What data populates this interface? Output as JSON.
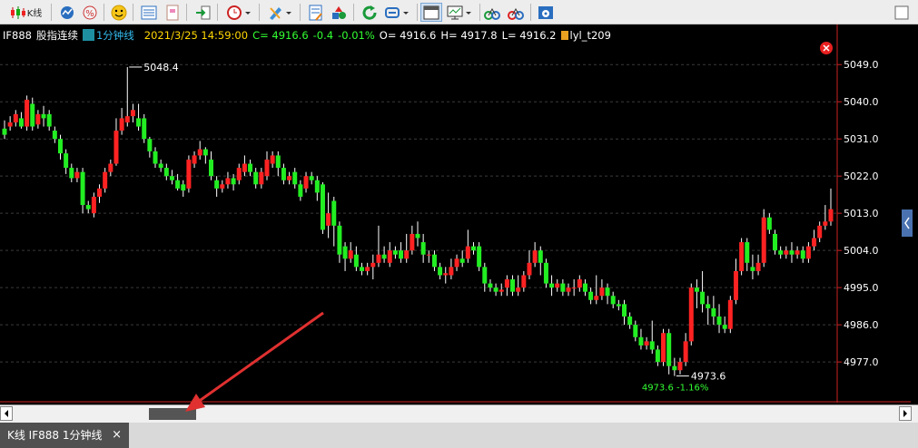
{
  "toolbar": {
    "kline_label": "K线"
  },
  "info": {
    "symbol": "IF888",
    "name": "股指连续",
    "period": "1分钟线",
    "datetime": "2021/3/25 14:59:00",
    "close": "C= 4916.6",
    "change": "-0.4",
    "pct": "-0.01%",
    "open": "O= 4916.6",
    "high": "H= 4917.8",
    "low": "L= 4916.2",
    "indicator": "lyl_t209"
  },
  "yaxis_ticks": [
    "5049.0",
    "5040.0",
    "5031.0",
    "5022.0",
    "5013.0",
    "5004.0",
    "4995.0",
    "4986.0",
    "4977.0"
  ],
  "annotations": {
    "high_label": "5048.4",
    "low_label": "4973.6",
    "low_change": "4973.6 -1.16%"
  },
  "tab": {
    "title": "K线 IF888 1分钟线",
    "close": "×"
  },
  "colors": {
    "up": "#ff2222",
    "down": "#22ee22",
    "axis": "#cc2222",
    "info_time": "#ffd700",
    "info_value": "#33ff33"
  },
  "chart_data": {
    "type": "candlestick",
    "ylim": [
      4970,
      5053
    ],
    "grid": true,
    "candles": [
      [
        5033.5,
        5032,
        5035.5,
        5031
      ],
      [
        5034,
        5035,
        5036.5,
        5033
      ],
      [
        5035,
        5037,
        5038,
        5034
      ],
      [
        5036,
        5034,
        5037.5,
        5033.5
      ],
      [
        5034,
        5040.5,
        5041.5,
        5033
      ],
      [
        5039.5,
        5034,
        5041,
        5033
      ],
      [
        5034.5,
        5037,
        5038,
        5033.5
      ],
      [
        5037,
        5036,
        5039,
        5034
      ],
      [
        5037,
        5034,
        5038,
        5033
      ],
      [
        5033,
        5031,
        5034,
        5030
      ],
      [
        5031,
        5027.5,
        5032,
        5026
      ],
      [
        5027.5,
        5024,
        5028.5,
        5022.5
      ],
      [
        5024,
        5021.5,
        5025,
        5020.5
      ],
      [
        5021.5,
        5023,
        5024,
        5020.5
      ],
      [
        5023,
        5015,
        5024,
        5013
      ],
      [
        5015,
        5014,
        5016,
        5013
      ],
      [
        5013,
        5017,
        5018,
        5012
      ],
      [
        5017,
        5019,
        5020,
        5015.5
      ],
      [
        5019,
        5023,
        5024,
        5018
      ],
      [
        5023,
        5025,
        5026,
        5022
      ],
      [
        5025,
        5033,
        5036,
        5024.5
      ],
      [
        5033,
        5036,
        5038.5,
        5032
      ],
      [
        5035,
        5036.5,
        5048.4,
        5034
      ],
      [
        5036.5,
        5038,
        5039.5,
        5035
      ],
      [
        5036,
        5034,
        5039.5,
        5033
      ],
      [
        5036,
        5031,
        5037,
        5030
      ],
      [
        5031,
        5028,
        5031.5,
        5026.5
      ],
      [
        5028,
        5025,
        5029,
        5024
      ],
      [
        5025,
        5024,
        5026,
        5023
      ],
      [
        5024,
        5022,
        5025,
        5021
      ],
      [
        5022,
        5021,
        5023.5,
        5020
      ],
      [
        5021,
        5019,
        5022.5,
        5018.5
      ],
      [
        5020,
        5018.5,
        5021,
        5017
      ],
      [
        5019,
        5026,
        5027,
        5018
      ],
      [
        5025,
        5027,
        5028,
        5024
      ],
      [
        5027,
        5028.5,
        5030.5,
        5026
      ],
      [
        5028.5,
        5027,
        5029,
        5025
      ],
      [
        5026,
        5022,
        5028,
        5021
      ],
      [
        5021,
        5019,
        5022,
        5017
      ],
      [
        5019,
        5020,
        5021,
        5018
      ],
      [
        5020,
        5021.5,
        5023,
        5019
      ],
      [
        5021.5,
        5020,
        5022.5,
        5018.5
      ],
      [
        5021,
        5024,
        5025,
        5020
      ],
      [
        5023,
        5025,
        5027,
        5022
      ],
      [
        5025,
        5023,
        5026,
        5022
      ],
      [
        5023,
        5020,
        5024,
        5019
      ],
      [
        5020,
        5023,
        5024,
        5019
      ],
      [
        5022,
        5026,
        5028,
        5021
      ],
      [
        5025,
        5027,
        5028,
        5024
      ],
      [
        5027,
        5024,
        5028,
        5022
      ],
      [
        5024,
        5021,
        5025,
        5020
      ],
      [
        5021,
        5022,
        5023,
        5020
      ],
      [
        5023,
        5020,
        5024,
        5019
      ],
      [
        5020,
        5017,
        5021,
        5016
      ],
      [
        5019,
        5022,
        5023,
        5018
      ],
      [
        5022,
        5021,
        5023,
        5020
      ],
      [
        5021,
        5018,
        5022,
        5016
      ],
      [
        5020,
        5009,
        5020.5,
        5008
      ],
      [
        5010,
        5013,
        5018,
        5007
      ],
      [
        5016,
        5010,
        5017,
        5005
      ],
      [
        5010,
        5003,
        5011,
        5001
      ],
      [
        5005,
        5002,
        5006,
        4999
      ],
      [
        5002,
        5004,
        5006,
        5001
      ],
      [
        5003,
        5000,
        5005,
        4999
      ],
      [
        5000,
        4999,
        5001,
        4998
      ],
      [
        4999,
        5000,
        5001,
        4998
      ],
      [
        5000,
        5001,
        5003,
        4997
      ],
      [
        5001,
        5003,
        5010,
        5000
      ],
      [
        5003,
        5002,
        5005,
        5001
      ],
      [
        5001,
        5004,
        5006,
        5000
      ],
      [
        5004,
        5003,
        5005,
        5002
      ],
      [
        5004,
        5002,
        5006,
        5001
      ],
      [
        5002,
        5004,
        5008,
        5001
      ],
      [
        5004,
        5008,
        5010,
        5003
      ],
      [
        5008,
        5007,
        5011,
        5005
      ],
      [
        5006,
        5003,
        5008,
        5001
      ],
      [
        5003,
        5003,
        5004,
        5001
      ],
      [
        5003,
        5000,
        5004,
        4999
      ],
      [
        5000,
        4998,
        5001,
        4997
      ],
      [
        4998,
        4998.5,
        5000,
        4996
      ],
      [
        4998,
        5000,
        5002,
        4997
      ],
      [
        5000,
        5002,
        5003,
        4999
      ],
      [
        5002,
        5001,
        5004,
        5000
      ],
      [
        5002,
        5005,
        5009,
        5001
      ],
      [
        5005,
        5004,
        5006,
        5003
      ],
      [
        5005,
        5000,
        5006,
        4999
      ],
      [
        5000,
        4996,
        5001,
        4994
      ],
      [
        4996,
        4995,
        4997,
        4994
      ],
      [
        4995,
        4994,
        4996,
        4993
      ],
      [
        4994,
        4994.5,
        4996,
        4993
      ],
      [
        4995,
        4997,
        4998,
        4993
      ],
      [
        4997,
        4994,
        4998,
        4993
      ],
      [
        4994,
        4995,
        4998,
        4993
      ],
      [
        4995,
        4998,
        4999,
        4994
      ],
      [
        4998,
        5001,
        5004,
        4997
      ],
      [
        5001,
        5004,
        5006,
        5000
      ],
      [
        5004,
        5001,
        5005,
        4998
      ],
      [
        5001,
        4996,
        5002,
        4995
      ],
      [
        4996,
        4995,
        4998,
        4993
      ],
      [
        4995,
        4996,
        4997,
        4994
      ],
      [
        4996,
        4994,
        4997,
        4993
      ],
      [
        4994,
        4995,
        4996,
        4993
      ],
      [
        4995,
        4995,
        4997,
        4993
      ],
      [
        4995,
        4997,
        4998,
        4994
      ],
      [
        4996,
        4994,
        4997,
        4993
      ],
      [
        4994,
        4992,
        4995,
        4991
      ],
      [
        4992,
        4993,
        4998,
        4991
      ],
      [
        4993,
        4995,
        4997,
        4992
      ],
      [
        4995,
        4993,
        4996,
        4991
      ],
      [
        4993,
        4991,
        4994,
        4990
      ],
      [
        4991,
        4990.5,
        4992,
        4989.5
      ],
      [
        4991,
        4988,
        4992,
        4986
      ],
      [
        4988,
        4986,
        4989,
        4985
      ],
      [
        4986,
        4983,
        4987,
        4982
      ],
      [
        4983,
        4981,
        4985,
        4980
      ],
      [
        4981,
        4982,
        4983,
        4980
      ],
      [
        4982,
        4980,
        4987,
        4979
      ],
      [
        4980,
        4977,
        4981,
        4976
      ],
      [
        4977,
        4984,
        4985,
        4976
      ],
      [
        4984,
        4976,
        4985,
        4974
      ],
      [
        4976,
        4975,
        4978,
        4973.6
      ],
      [
        4975,
        4977,
        4978,
        4974
      ],
      [
        4977,
        4982,
        4984,
        4976
      ],
      [
        4982,
        4995,
        4996,
        4981
      ],
      [
        4995,
        4994,
        4997,
        4990
      ],
      [
        4994,
        4991,
        4999,
        4989
      ],
      [
        4991,
        4990,
        4993,
        4986
      ],
      [
        4990,
        4988,
        4993,
        4986
      ],
      [
        4988,
        4986,
        4991,
        4984
      ],
      [
        4986,
        4985,
        4988,
        4984
      ],
      [
        4985,
        4992,
        4993,
        4984
      ],
      [
        4992,
        4999,
        5002,
        4991
      ],
      [
        4999,
        5006,
        5007,
        4998
      ],
      [
        5006,
        5001,
        5007,
        4999
      ],
      [
        5000,
        4999,
        5003,
        4997
      ],
      [
        4999,
        5001,
        5003,
        4998
      ],
      [
        5001,
        5012,
        5014,
        5000
      ],
      [
        5012,
        5009,
        5013,
        5008
      ],
      [
        5008,
        5004,
        5009,
        5003
      ],
      [
        5004,
        5003,
        5005,
        5002
      ],
      [
        5003,
        5004,
        5005,
        5002
      ],
      [
        5004,
        5003,
        5006,
        5001
      ],
      [
        5003,
        5004,
        5005,
        5002
      ],
      [
        5004,
        5002,
        5005,
        5001
      ],
      [
        5002,
        5005,
        5006,
        5001
      ],
      [
        5005,
        5007,
        5009,
        5004
      ],
      [
        5007,
        5010,
        5011,
        5006
      ],
      [
        5010,
        5011,
        5015,
        5009
      ],
      [
        5011,
        5014,
        5019,
        5010
      ]
    ]
  }
}
